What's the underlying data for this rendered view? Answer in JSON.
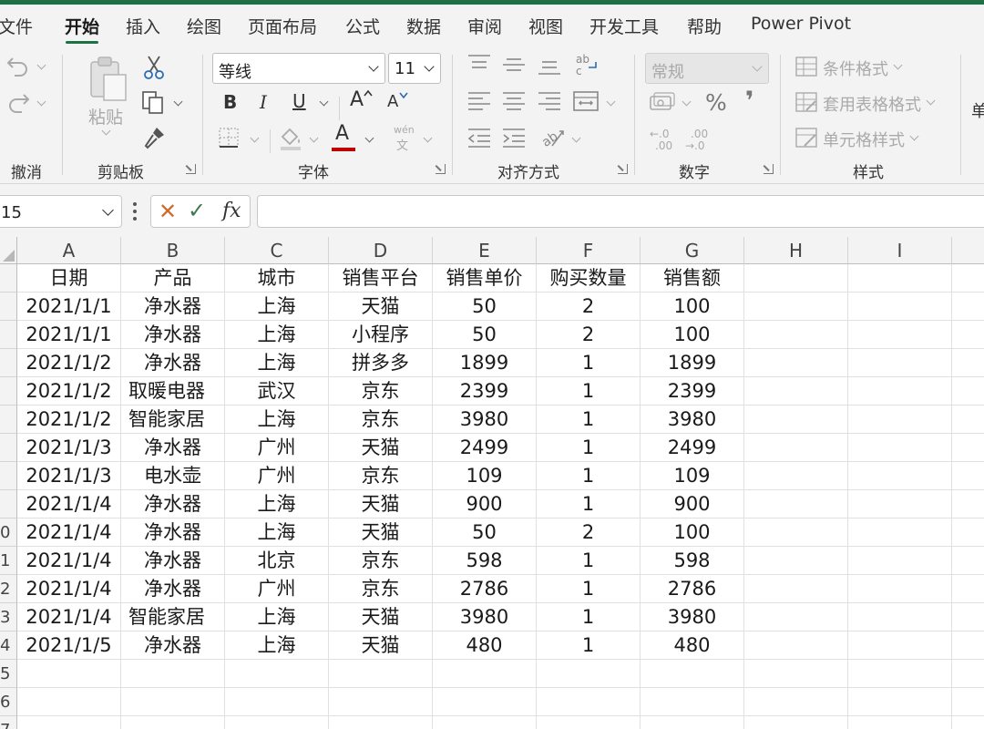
{
  "menu": {
    "tabs": [
      "文件",
      "开始",
      "插入",
      "绘图",
      "页面布局",
      "公式",
      "数据",
      "审阅",
      "视图",
      "开发工具",
      "帮助",
      "Power Pivot"
    ],
    "active": 1
  },
  "ribbon": {
    "groups": {
      "undo": "撤消",
      "clipboard": "剪贴板",
      "font": "字体",
      "align": "对齐方式",
      "number": "数字",
      "styles": "样式"
    },
    "paste_label": "粘贴",
    "font_name": "等线",
    "font_size": "11",
    "bold": "B",
    "italic": "I",
    "underline": "U",
    "grow_font": "A",
    "shrink_font": "A",
    "font_color_glyph": "A",
    "phonetic_top": "wén",
    "phonetic_bottom": "文",
    "number_format": "常规",
    "percent": "%",
    "comma": "❜",
    "inc_decimal_top": "←.0",
    "inc_decimal_bottom": ".00",
    "dec_decimal_top": ".00",
    "dec_decimal_bottom": "→.0",
    "cond_format": "条件格式",
    "table_format": "套用表格格式",
    "cell_style": "单元格样式",
    "cut_off_label": "单",
    "accent_color": "#1e7145",
    "font_color_bar": "#c00000"
  },
  "formula_bar": {
    "name_box": "15",
    "fx": "fx",
    "cancel": "✕",
    "enter": "✓",
    "formula": ""
  },
  "sheet": {
    "columns": [
      "A",
      "B",
      "C",
      "D",
      "E",
      "F",
      "G",
      "H",
      "I"
    ],
    "row_numbers": [
      "",
      "",
      "",
      "",
      "",
      "",
      "",
      "",
      "",
      "0",
      "1",
      "2",
      "3",
      "4",
      "5",
      "6",
      "7"
    ],
    "rows": [
      [
        "日期",
        "产品",
        "城市",
        "销售平台",
        "销售单价",
        "购买数量",
        "销售额"
      ],
      [
        "2021/1/1",
        "净水器",
        "上海",
        "天猫",
        "50",
        "2",
        "100"
      ],
      [
        "2021/1/1",
        "净水器",
        "上海",
        "小程序",
        "50",
        "2",
        "100"
      ],
      [
        "2021/1/2",
        "净水器",
        "上海",
        "拼多多",
        "1899",
        "1",
        "1899"
      ],
      [
        "2021/1/2",
        "取暖电器",
        "武汉",
        "京东",
        "2399",
        "1",
        "2399"
      ],
      [
        "2021/1/2",
        "智能家居",
        "上海",
        "京东",
        "3980",
        "1",
        "3980"
      ],
      [
        "2021/1/3",
        "净水器",
        "广州",
        "天猫",
        "2499",
        "1",
        "2499"
      ],
      [
        "2021/1/3",
        "电水壶",
        "广州",
        "京东",
        "109",
        "1",
        "109"
      ],
      [
        "2021/1/4",
        "净水器",
        "上海",
        "天猫",
        "900",
        "1",
        "900"
      ],
      [
        "2021/1/4",
        "净水器",
        "上海",
        "天猫",
        "50",
        "2",
        "100"
      ],
      [
        "2021/1/4",
        "净水器",
        "北京",
        "京东",
        "598",
        "1",
        "598"
      ],
      [
        "2021/1/4",
        "净水器",
        "广州",
        "京东",
        "2786",
        "1",
        "2786"
      ],
      [
        "2021/1/4",
        "智能家居",
        "上海",
        "天猫",
        "3980",
        "1",
        "3980"
      ],
      [
        "2021/1/5",
        "净水器",
        "上海",
        "天猫",
        "480",
        "1",
        "480"
      ]
    ]
  }
}
